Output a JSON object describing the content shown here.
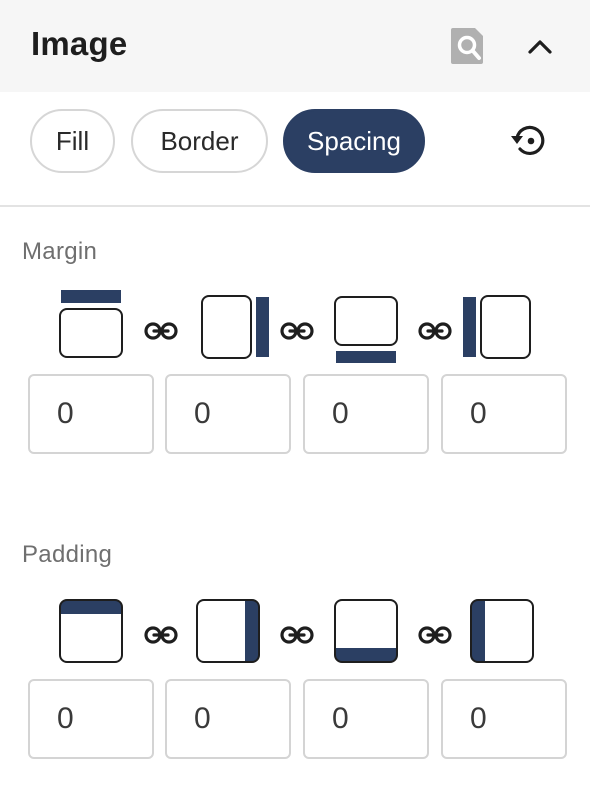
{
  "header": {
    "title": "Image",
    "search_icon": "magnifier-icon",
    "collapse_icon": "chevron-up-icon"
  },
  "tabs": [
    {
      "label": "Fill",
      "active": false
    },
    {
      "label": "Border",
      "active": false
    },
    {
      "label": "Spacing",
      "active": true
    }
  ],
  "reset_icon": "reset-icon",
  "margin": {
    "label": "Margin",
    "values": {
      "top": "0",
      "right": "0",
      "bottom": "0",
      "left": "0"
    }
  },
  "padding": {
    "label": "Padding",
    "values": {
      "top": "0",
      "right": "0",
      "bottom": "0",
      "left": "0"
    }
  },
  "colors": {
    "accent": "#2b3f63",
    "header_bg": "#f6f6f6",
    "border": "#d6d6d6",
    "label": "#6f6f6f"
  }
}
